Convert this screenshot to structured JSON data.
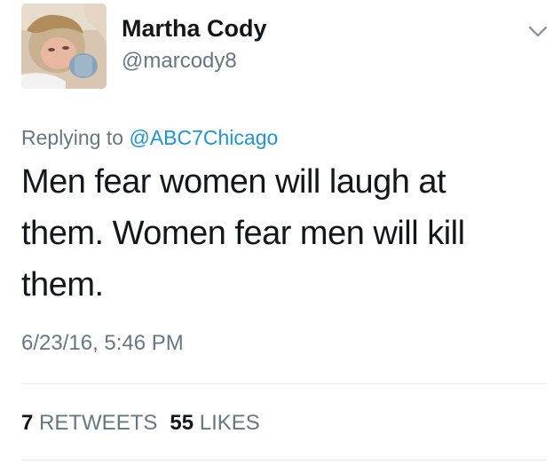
{
  "tweet": {
    "author": {
      "display_name": "Martha Cody",
      "handle": "@marcody8"
    },
    "reply": {
      "prefix": "Replying to ",
      "mention": "@ABC7Chicago"
    },
    "text": "Men fear women will laugh at them. Women fear men will kill them.",
    "timestamp": "6/23/16, 5:46 PM",
    "stats": {
      "retweets_count": "7",
      "retweets_label": "RETWEETS",
      "likes_count": "55",
      "likes_label": "LIKES"
    }
  },
  "icons": {
    "menu": "chevron-down-icon",
    "avatar": "avatar"
  },
  "colors": {
    "text": "#14171a",
    "secondary": "#657786",
    "link": "#1b95e0",
    "divider": "#e1e8ed"
  }
}
